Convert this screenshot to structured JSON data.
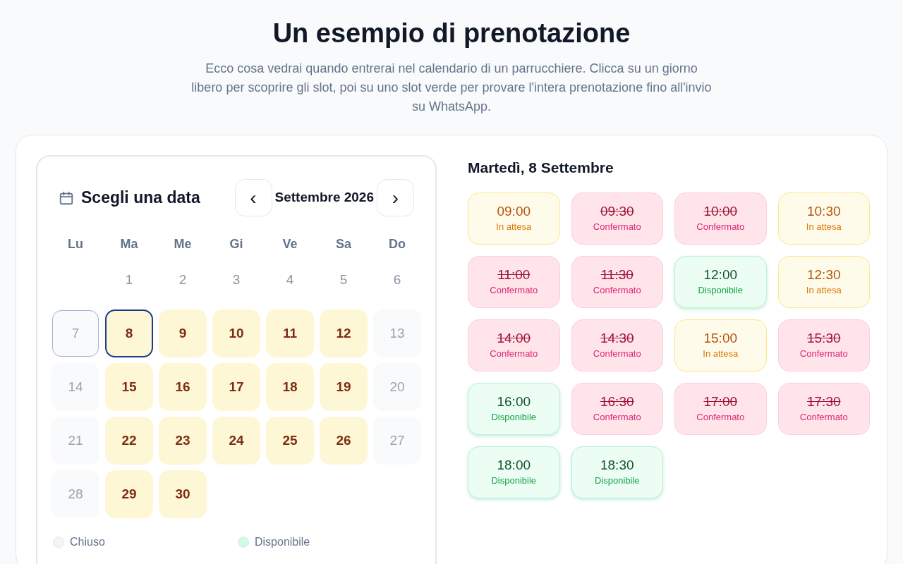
{
  "title": "Un esempio di prenotazione",
  "subtitle": "Ecco cosa vedrai quando entrerai nel calendario di un parrucchiere. Clicca su un giorno libero per scoprire gli slot, poi su uno slot verde per provare l'intera prenotazione fino all'invio su WhatsApp.",
  "calendar": {
    "heading": "Scegli una data",
    "prev": "‹",
    "month": "Settembre 2026",
    "next": "›",
    "weekdays": [
      "Lu",
      "Ma",
      "Me",
      "Gi",
      "Ve",
      "Sa",
      "Do"
    ],
    "days": [
      {
        "kind": "blank"
      },
      {
        "label": "1",
        "kind": "past",
        "selected": false
      },
      {
        "label": "2",
        "kind": "past",
        "selected": false
      },
      {
        "label": "3",
        "kind": "past",
        "selected": false
      },
      {
        "label": "4",
        "kind": "past",
        "selected": false
      },
      {
        "label": "5",
        "kind": "past",
        "selected": false
      },
      {
        "label": "6",
        "kind": "past",
        "selected": false
      },
      {
        "label": "7",
        "kind": "today",
        "selected": false
      },
      {
        "label": "8",
        "kind": "open",
        "selected": true
      },
      {
        "label": "9",
        "kind": "open",
        "selected": false
      },
      {
        "label": "10",
        "kind": "open",
        "selected": false
      },
      {
        "label": "11",
        "kind": "open",
        "selected": false
      },
      {
        "label": "12",
        "kind": "open",
        "selected": false
      },
      {
        "label": "13",
        "kind": "closed",
        "selected": false
      },
      {
        "label": "14",
        "kind": "closed",
        "selected": false
      },
      {
        "label": "15",
        "kind": "open",
        "selected": false
      },
      {
        "label": "16",
        "kind": "open",
        "selected": false
      },
      {
        "label": "17",
        "kind": "open",
        "selected": false
      },
      {
        "label": "18",
        "kind": "open",
        "selected": false
      },
      {
        "label": "19",
        "kind": "open",
        "selected": false
      },
      {
        "label": "20",
        "kind": "closed",
        "selected": false
      },
      {
        "label": "21",
        "kind": "closed",
        "selected": false
      },
      {
        "label": "22",
        "kind": "open",
        "selected": false
      },
      {
        "label": "23",
        "kind": "open",
        "selected": false
      },
      {
        "label": "24",
        "kind": "open",
        "selected": false
      },
      {
        "label": "25",
        "kind": "open",
        "selected": false
      },
      {
        "label": "26",
        "kind": "open",
        "selected": false
      },
      {
        "label": "27",
        "kind": "closed",
        "selected": false
      },
      {
        "label": "28",
        "kind": "closed",
        "selected": false
      },
      {
        "label": "29",
        "kind": "open",
        "selected": false
      },
      {
        "label": "30",
        "kind": "open",
        "selected": false
      }
    ],
    "legend": [
      {
        "label": "Chiuso",
        "color": "#f3f4f6"
      },
      {
        "label": "Disponibile",
        "color": "#d1fae5"
      }
    ]
  },
  "slots_panel": {
    "heading": "Martedì, 8 Settembre",
    "slots": [
      {
        "time": "09:00",
        "status": "In attesa",
        "kind": "pending"
      },
      {
        "time": "09:30",
        "status": "Confermato",
        "kind": "booked"
      },
      {
        "time": "10:00",
        "status": "Confermato",
        "kind": "booked"
      },
      {
        "time": "10:30",
        "status": "In attesa",
        "kind": "pending"
      },
      {
        "time": "11:00",
        "status": "Confermato",
        "kind": "booked"
      },
      {
        "time": "11:30",
        "status": "Confermato",
        "kind": "booked"
      },
      {
        "time": "12:00",
        "status": "Disponibile",
        "kind": "free"
      },
      {
        "time": "12:30",
        "status": "In attesa",
        "kind": "pending"
      },
      {
        "time": "14:00",
        "status": "Confermato",
        "kind": "booked"
      },
      {
        "time": "14:30",
        "status": "Confermato",
        "kind": "booked"
      },
      {
        "time": "15:00",
        "status": "In attesa",
        "kind": "pending"
      },
      {
        "time": "15:30",
        "status": "Confermato",
        "kind": "booked"
      },
      {
        "time": "16:00",
        "status": "Disponibile",
        "kind": "free"
      },
      {
        "time": "16:30",
        "status": "Confermato",
        "kind": "booked"
      },
      {
        "time": "17:00",
        "status": "Confermato",
        "kind": "booked"
      },
      {
        "time": "17:30",
        "status": "Confermato",
        "kind": "booked"
      },
      {
        "time": "18:00",
        "status": "Disponibile",
        "kind": "free"
      },
      {
        "time": "18:30",
        "status": "Disponibile",
        "kind": "free"
      }
    ]
  }
}
